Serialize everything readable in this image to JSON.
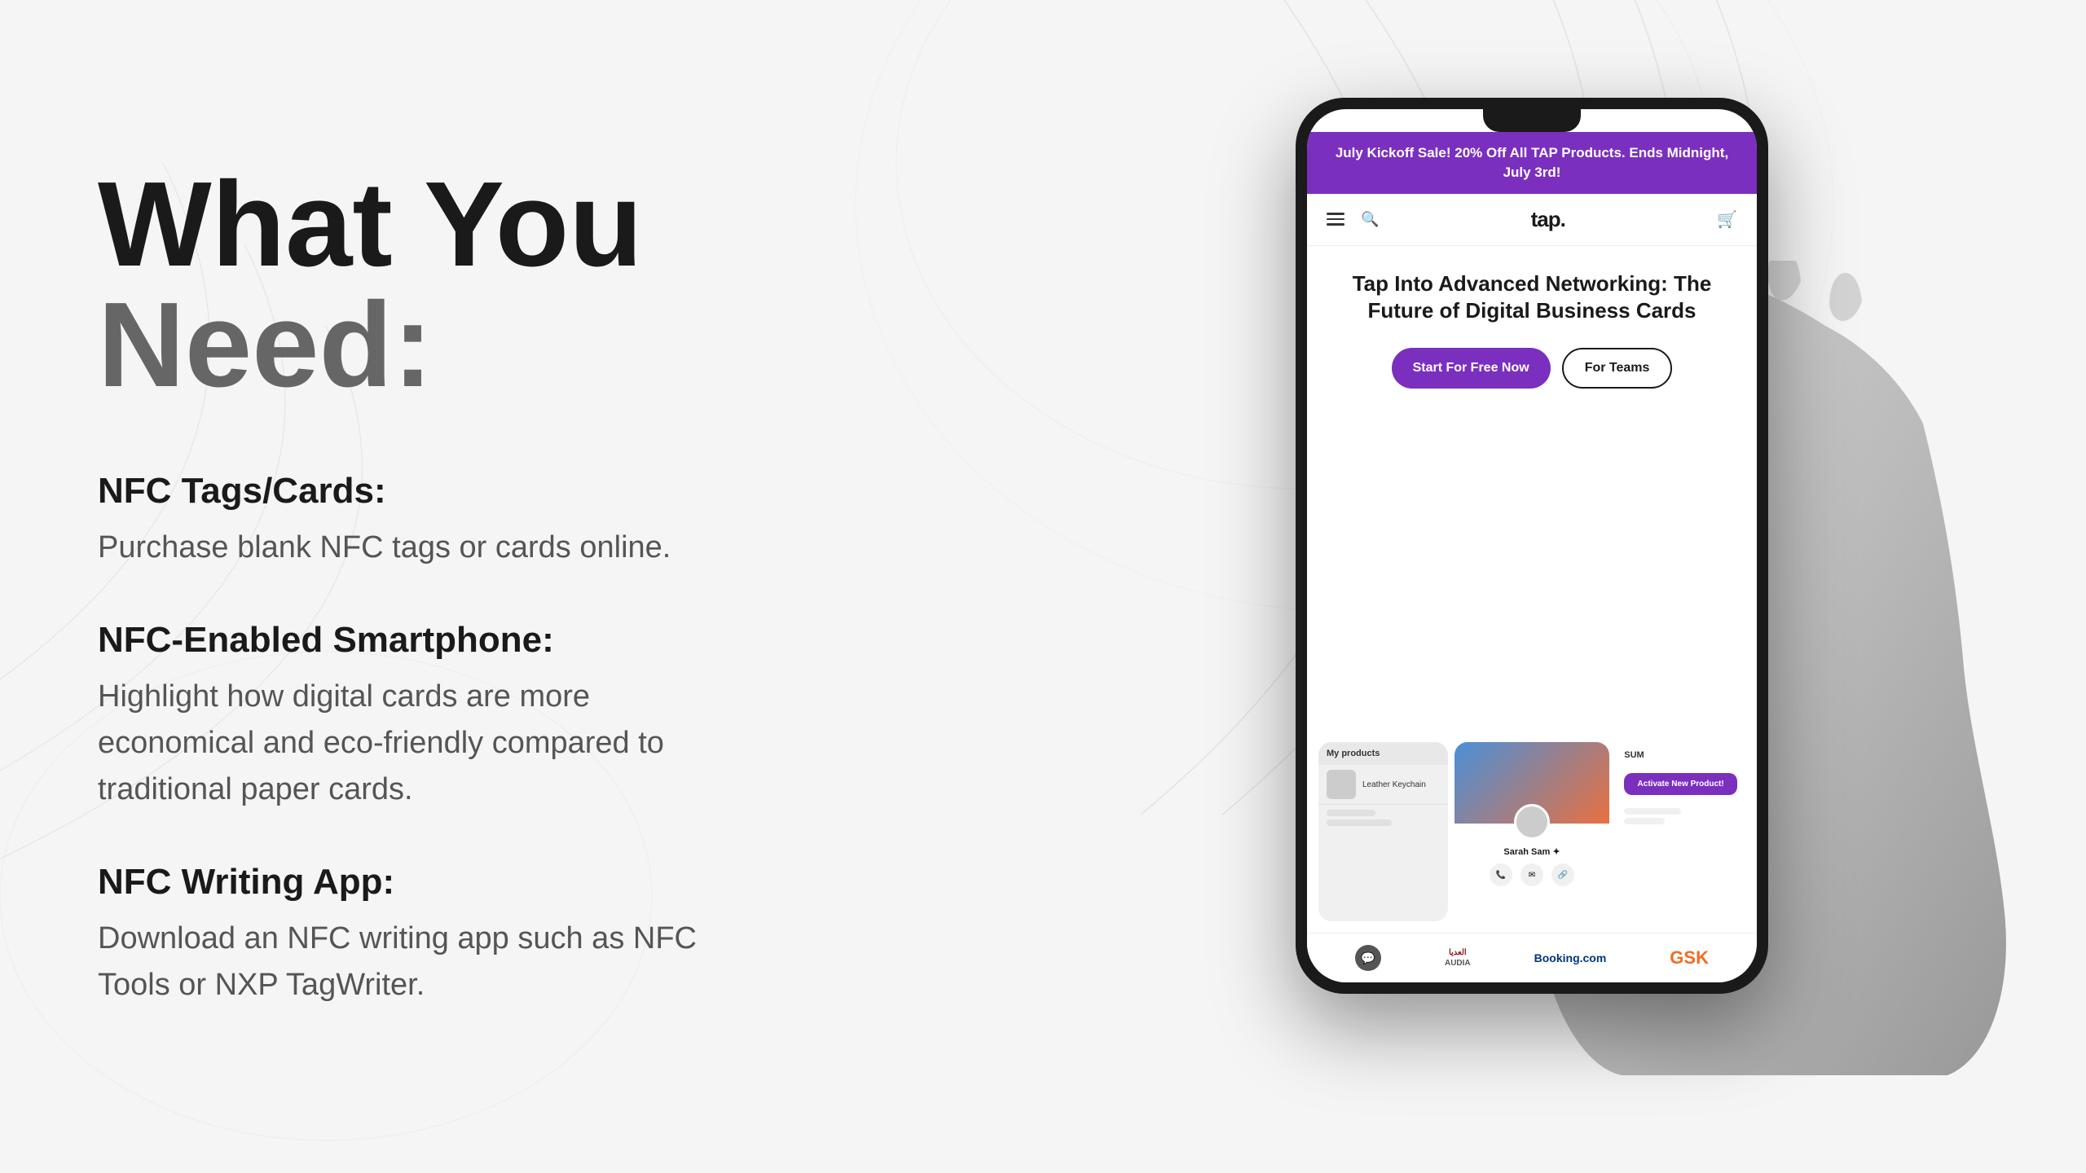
{
  "page": {
    "background_color": "#f2f2f2"
  },
  "hero": {
    "title_line1": "What You",
    "title_line2": "Need:"
  },
  "features": [
    {
      "title": "NFC Tags/Cards:",
      "description": "Purchase blank NFC tags or cards online."
    },
    {
      "title": "NFC-Enabled Smartphone:",
      "description": "Highlight how digital cards are more economical and eco-friendly compared to traditional paper cards."
    },
    {
      "title": "NFC Writing App:",
      "description": "Download an NFC writing app such as NFC Tools or NXP TagWriter."
    }
  ],
  "phone": {
    "promo_banner": "July Kickoff Sale! 20% Off All TAP Products. Ends Midnight, July 3rd!",
    "logo": "tap.",
    "hero_headline": "Tap Into Advanced Networking: The Future of Digital Business Cards",
    "btn_start": "Start For Free Now",
    "btn_teams": "For Teams",
    "products_header": "My products",
    "product_name": "Leather Keychain",
    "profile_name": "Sarah Sam ✦",
    "activate_label": "Activate New Product!",
    "brands": [
      "AUDIA",
      "Booking.com",
      "GSK"
    ]
  }
}
